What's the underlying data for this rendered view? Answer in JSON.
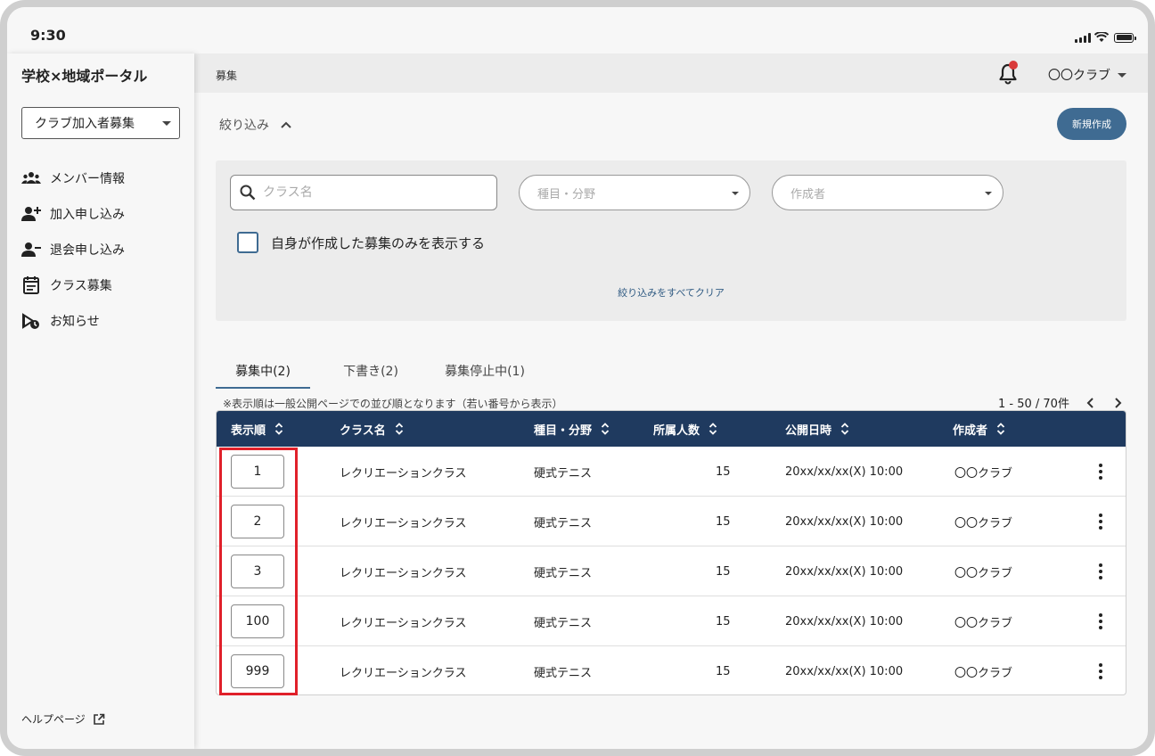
{
  "status_bar": {
    "time": "9:30"
  },
  "sidebar": {
    "app_title": "学校×地域ポータル",
    "club_select": "クラブ加入者募集",
    "items": [
      {
        "label": "メンバー情報",
        "icon": "members-icon"
      },
      {
        "label": "加入申し込み",
        "icon": "person-add-icon"
      },
      {
        "label": "退会申し込み",
        "icon": "person-remove-icon"
      },
      {
        "label": "クラス募集",
        "icon": "calendar-icon"
      },
      {
        "label": "お知らせ",
        "icon": "announcement-icon"
      }
    ],
    "help": "ヘルプページ"
  },
  "header": {
    "breadcrumb": "募集",
    "user": "〇〇クラブ"
  },
  "filter": {
    "toggle_label": "絞り込み",
    "new_button": "新規作成",
    "search_placeholder": "クラス名",
    "category_placeholder": "種目・分野",
    "author_placeholder": "作成者",
    "checkbox_label": "自身が作成した募集のみを表示する",
    "clear_link": "絞り込みをすべてクリア"
  },
  "tabs": [
    {
      "label": "募集中(2)"
    },
    {
      "label": "下書き(2)"
    },
    {
      "label": "募集停止中(1)"
    }
  ],
  "note": "※表示順は一般公開ページでの並び順となります（若い番号から表示）",
  "pager": {
    "range": "1 - 50 / 70件"
  },
  "table": {
    "headers": [
      "表示順",
      "クラス名",
      "種目・分野",
      "所属人数",
      "公開日時",
      "作成者"
    ],
    "rows": [
      {
        "order": "1",
        "name": "レクリエーションクラス",
        "category": "硬式テニス",
        "members": "15",
        "date": "20xx/xx/xx(X) 10:00",
        "author": "〇〇クラブ"
      },
      {
        "order": "2",
        "name": "レクリエーションクラス",
        "category": "硬式テニス",
        "members": "15",
        "date": "20xx/xx/xx(X) 10:00",
        "author": "〇〇クラブ"
      },
      {
        "order": "3",
        "name": "レクリエーションクラス",
        "category": "硬式テニス",
        "members": "15",
        "date": "20xx/xx/xx(X) 10:00",
        "author": "〇〇クラブ"
      },
      {
        "order": "100",
        "name": "レクリエーションクラス",
        "category": "硬式テニス",
        "members": "15",
        "date": "20xx/xx/xx(X) 10:00",
        "author": "〇〇クラブ"
      },
      {
        "order": "999",
        "name": "レクリエーションクラス",
        "category": "硬式テニス",
        "members": "15",
        "date": "20xx/xx/xx(X) 10:00",
        "author": "〇〇クラブ"
      }
    ]
  },
  "colors": {
    "primary": "#3f6b92",
    "table_header": "#1f3a5f",
    "highlight": "#e0202a",
    "notification": "#d93a3a"
  }
}
